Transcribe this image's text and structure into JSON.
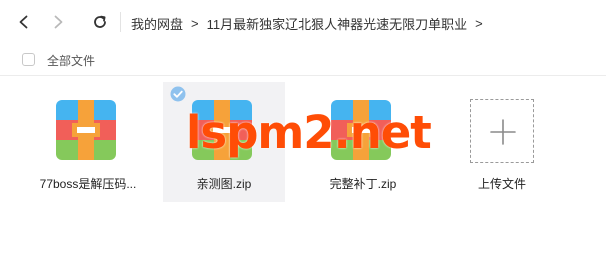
{
  "toolbar": {
    "back_icon": "chevron-left-icon",
    "forward_icon": "chevron-right-icon",
    "refresh_icon": "refresh-icon"
  },
  "breadcrumb": {
    "items": [
      "我的网盘",
      "11月最新独家辽北狠人神器光速无限刀单职业"
    ],
    "separator": ">"
  },
  "select_all": {
    "label": "全部文件"
  },
  "files": [
    {
      "name": "77boss是解压码...",
      "icon": "zip-archive-icon",
      "selected": false
    },
    {
      "name": "亲测图.zip",
      "icon": "zip-archive-icon",
      "selected": true
    },
    {
      "name": "完整补丁.zip",
      "icon": "zip-archive-icon",
      "selected": false
    }
  ],
  "upload": {
    "label": "上传文件",
    "icon": "plus-icon"
  },
  "watermark": {
    "text": "lspm2.net",
    "color": "#ff4d06"
  },
  "colors": {
    "selected_tile": "#f2f2f4",
    "check_badge": "#8fc2ee",
    "zip_red": "#f15f59",
    "zip_blue": "#45b4f0",
    "zip_green": "#85c95b",
    "zip_orange": "#f6a23a"
  }
}
